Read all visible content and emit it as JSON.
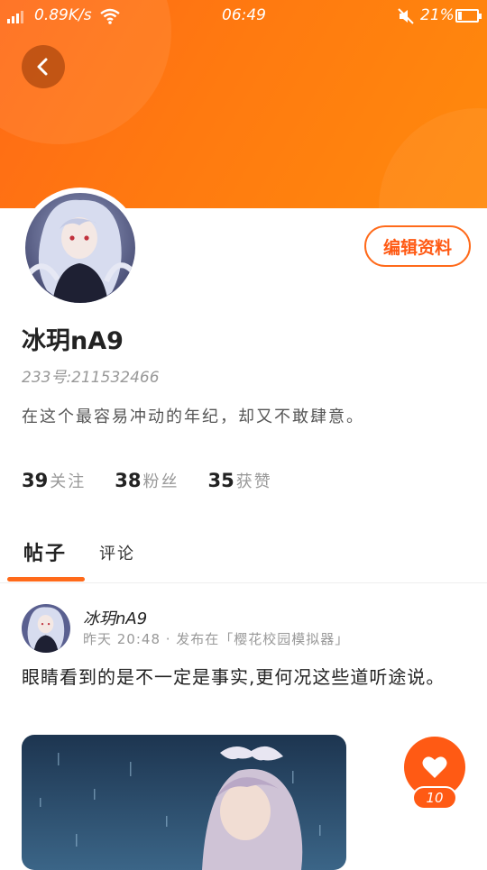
{
  "status_bar": {
    "net_speed": "0.89K/s",
    "time": "06:49",
    "battery": "21%",
    "battery_level": 0.21
  },
  "profile": {
    "edit_button_label": "编辑资料",
    "username": "冰玥nA9",
    "uid": "233号:211532466",
    "bio": "在这个最容易冲动的年纪，却又不敢肆意。",
    "stats": [
      {
        "value": "39",
        "label": "关注"
      },
      {
        "value": "38",
        "label": "粉丝"
      },
      {
        "value": "35",
        "label": "获赞"
      }
    ]
  },
  "tabs": [
    {
      "label": "帖子",
      "active": true
    },
    {
      "label": "评论",
      "active": false
    }
  ],
  "post": {
    "author": "冰玥nA9",
    "meta": "昨天 20:48 · 发布在「樱花校园模拟器」",
    "text": "眼睛看到的是不一定是事实,更何况这些道听途说。",
    "like_count": "10"
  },
  "colors": {
    "accent": "#ff6a1a",
    "header_start": "#ff6a16",
    "header_end": "#ff8a0c"
  },
  "icons": {
    "back": "chevron-left-icon",
    "signal": "signal-icon",
    "wifi": "wifi-icon",
    "mute": "mute-icon",
    "battery": "battery-icon",
    "like": "heart-icon"
  }
}
